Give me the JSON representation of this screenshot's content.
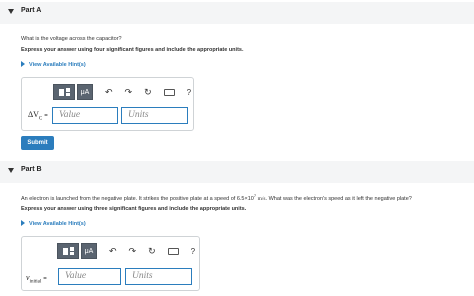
{
  "partA": {
    "header": "Part A",
    "question": "What is the voltage across the capacitor?",
    "instructions": "Express your answer using four significant figures and include the appropriate units.",
    "hint_link": "View Available Hint(s)",
    "toolbar": {
      "mu": "μA",
      "undo": "↶",
      "redo": "↷",
      "reset": "↻",
      "help": "?"
    },
    "variable": "ΔV",
    "variable_sub": "C",
    "equals": "=",
    "value_placeholder": "Value",
    "units_placeholder": "Units",
    "submit": "Submit"
  },
  "partB": {
    "header": "Part B",
    "question_pre": "An electron is launched from the negative plate. It strikes the positive plate at a speed of 6.5×10",
    "question_exp": "7",
    "question_unit": "m/s",
    "question_post": ". What was the electron's speed as it left the negative plate?",
    "instructions": "Express your answer using three significant figures and include the appropriate units.",
    "hint_link": "View Available Hint(s)",
    "toolbar": {
      "mu": "μA",
      "undo": "↶",
      "redo": "↷",
      "reset": "↻",
      "help": "?"
    },
    "variable": "v",
    "variable_sub": "initial",
    "equals": "=",
    "value_placeholder": "Value",
    "units_placeholder": "Units"
  }
}
